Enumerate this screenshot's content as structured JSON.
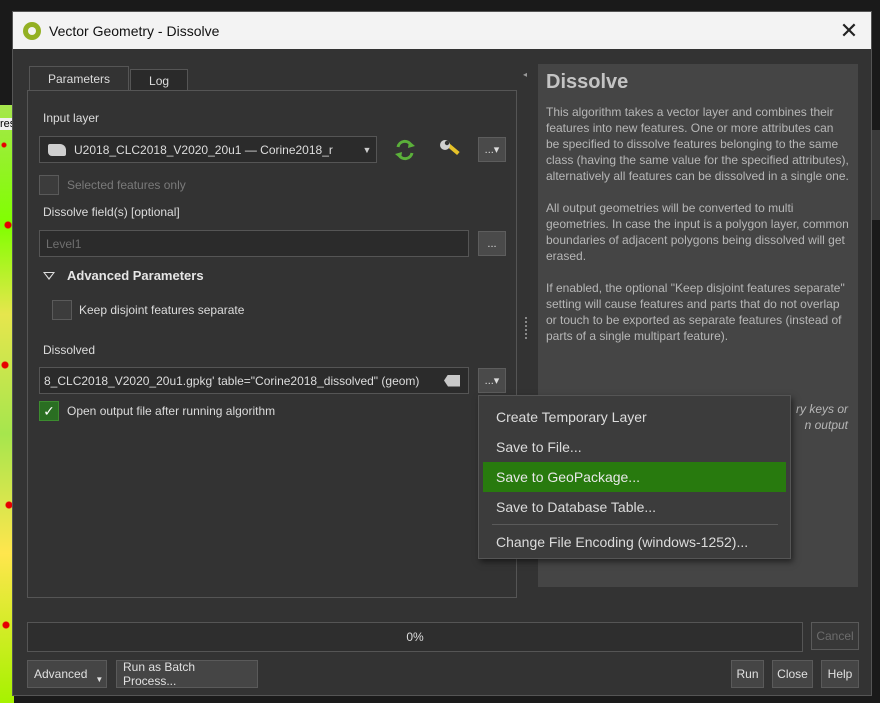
{
  "window": {
    "title": "Vector Geometry - Dissolve",
    "close_glyph": "✕"
  },
  "tabs": [
    {
      "label": "Parameters"
    },
    {
      "label": "Log"
    }
  ],
  "input_layer": {
    "label": "Input layer",
    "value": "U2018_CLC2018_V2020_20u1 — Corine2018_r",
    "selected_only_label": "Selected features only",
    "dots": "...▾"
  },
  "dissolve_fields": {
    "label": "Dissolve field(s) [optional]",
    "value": "Level1",
    "dots": "..."
  },
  "advanced": {
    "header": "Advanced Parameters",
    "keep_disjoint_label": "Keep disjoint features separate"
  },
  "output": {
    "label": "Dissolved",
    "value": "8_CLC2018_V2020_20u1.gpkg' table=\"Corine2018_dissolved\" (geom)",
    "dots": "...▾",
    "open_after_label": "Open output file after running algorithm",
    "open_after_checked": true
  },
  "menu": {
    "items": [
      {
        "label": "Create Temporary Layer"
      },
      {
        "label": "Save to File..."
      },
      {
        "label": "Save to GeoPackage..."
      },
      {
        "label": "Save to Database Table..."
      },
      {
        "label": "Change File Encoding (windows-1252)..."
      }
    ],
    "active_index": 2,
    "active_color": "#287a0e"
  },
  "help": {
    "title": "Dissolve",
    "p1": "This algorithm takes a vector layer and combines their features into new features. One or more attributes can be specified to dissolve features belonging to the same class (having the same value for the specified attributes), alternatively all features can be dissolved in a single one.",
    "p2": "All output geometries will be converted to multi geometries. In case the input is a polygon layer, common boundaries of adjacent polygons being dissolved will get erased.",
    "p3": "If enabled, the optional \"Keep disjoint features separate\" setting will cause features and parts that do not overlap or touch to be exported as separate features (instead of parts of a single multipart feature).",
    "partial1": "ry keys or",
    "partial2": "n output"
  },
  "progress": {
    "text": "0%",
    "value": 0
  },
  "buttons": {
    "cancel": "Cancel",
    "advanced": "Advanced",
    "batch": "Run as Batch Process...",
    "run": "Run",
    "close": "Close",
    "help": "Help"
  },
  "background": {
    "map_label": "res"
  }
}
